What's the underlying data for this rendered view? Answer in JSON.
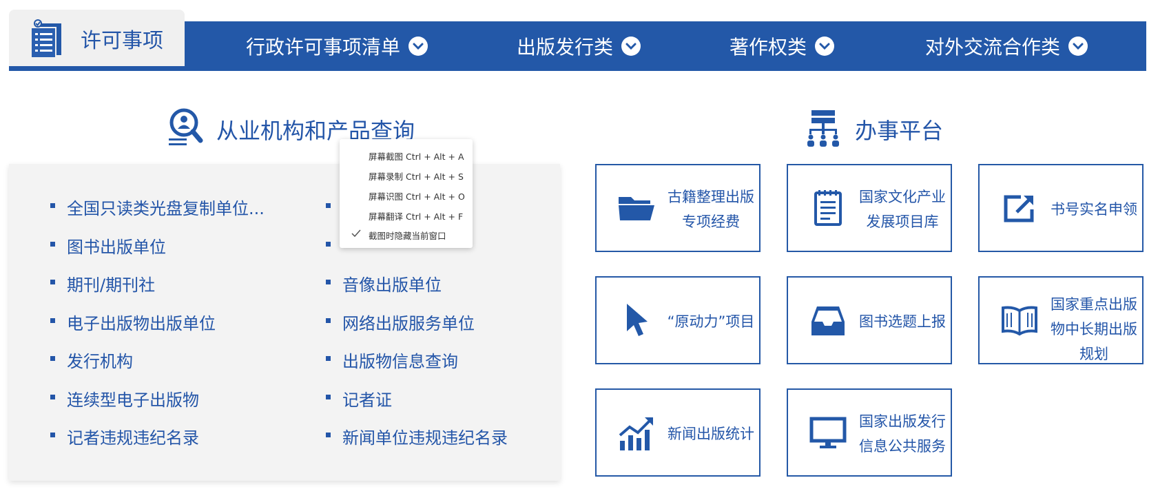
{
  "nav": {
    "home_label": "许可事项",
    "menus": [
      {
        "label": "行政许可事项清单"
      },
      {
        "label": "出版发行类"
      },
      {
        "label": "著作权类"
      },
      {
        "label": "对外交流合作类"
      }
    ]
  },
  "query": {
    "title": "从业机构和产品查询",
    "left_items": [
      "全国只读类光盘复制单位...",
      "图书出版单位",
      "期刊/期刊社",
      "电子出版物出版单位",
      "发行机构",
      "连续型电子出版物",
      "记者违规违纪名录"
    ],
    "right_items": [
      "",
      "",
      "音像出版单位",
      "网络出版服务单位",
      "出版物信息查询",
      "记者证",
      "新闻单位违规违纪名录"
    ]
  },
  "platform": {
    "title": "办事平台",
    "tiles": [
      {
        "icon": "folder-icon",
        "label": "古籍整理出版专项经费"
      },
      {
        "icon": "notepad-icon",
        "label": "国家文化产业发展项目库"
      },
      {
        "icon": "external-link-icon",
        "label": "书号实名申领"
      },
      {
        "icon": "cursor-icon",
        "label": "“原动力”项目"
      },
      {
        "icon": "inbox-icon",
        "label": "图书选题上报"
      },
      {
        "icon": "open-book-icon",
        "label": "国家重点出版物中长期出版规划"
      },
      {
        "icon": "bar-chart-icon",
        "label": "新闻出版统计"
      },
      {
        "icon": "monitor-icon",
        "label": "国家出版发行信息公共服务"
      }
    ]
  },
  "context_menu": {
    "items": [
      "屏幕截图 Ctrl + Alt + A",
      "屏幕录制 Ctrl + Alt + S",
      "屏幕识图 Ctrl + Alt + O",
      "屏幕翻译 Ctrl + Alt + F",
      "截图时隐藏当前窗口"
    ]
  },
  "colors": {
    "brand_blue": "#2358a8",
    "panel_gray": "#f3f3f3"
  }
}
